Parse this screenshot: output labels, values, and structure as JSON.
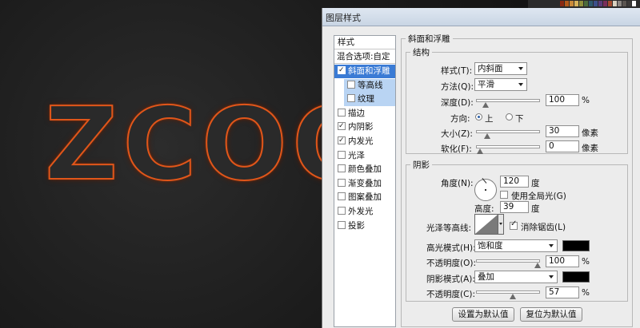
{
  "canvas": {
    "text": "ZCOO"
  },
  "topbar": {
    "swatch_colors": [
      "#8a2a12",
      "#b35a1a",
      "#c98a3a",
      "#d6b25a",
      "#8f8f3a",
      "#4c6b3a",
      "#2e5a6e",
      "#3c4f8a",
      "#5a3c7a",
      "#7a2e5a",
      "#a64a2e",
      "#d9d2c0",
      "#8a8580",
      "#5a5550",
      "#3c3a38",
      "#ffffff"
    ]
  },
  "dialog": {
    "title": "图层样式",
    "style_list": {
      "header": "样式",
      "blend": "混合选项:自定",
      "items": [
        {
          "label": "斜面和浮雕",
          "checked": true,
          "state": "selected"
        },
        {
          "label": "等高线",
          "checked": false,
          "state": "sub"
        },
        {
          "label": "纹理",
          "checked": false,
          "state": "sub"
        },
        {
          "label": "描边",
          "checked": false,
          "state": "normal"
        },
        {
          "label": "内阴影",
          "checked": true,
          "state": "normal"
        },
        {
          "label": "内发光",
          "checked": true,
          "state": "normal"
        },
        {
          "label": "光泽",
          "checked": false,
          "state": "normal"
        },
        {
          "label": "颜色叠加",
          "checked": false,
          "state": "normal"
        },
        {
          "label": "渐变叠加",
          "checked": false,
          "state": "normal"
        },
        {
          "label": "图案叠加",
          "checked": false,
          "state": "normal"
        },
        {
          "label": "外发光",
          "checked": false,
          "state": "normal"
        },
        {
          "label": "投影",
          "checked": false,
          "state": "normal"
        }
      ]
    },
    "bevel": {
      "title": "斜面和浮雕",
      "structure": {
        "title": "结构",
        "style_label": "样式(T):",
        "style_value": "内斜面",
        "technique_label": "方法(Q):",
        "technique_value": "平滑",
        "depth_label": "深度(D):",
        "depth_value": "100",
        "depth_unit": "%",
        "depth_fraction": 0.1,
        "direction_label": "方向:",
        "direction_up": "上",
        "direction_down": "下",
        "size_label": "大小(Z):",
        "size_value": "30",
        "size_unit": "像素",
        "size_fraction": 0.12,
        "soften_label": "软化(F):",
        "soften_value": "0",
        "soften_unit": "像素",
        "soften_fraction": 0.0
      },
      "shading": {
        "title": "阴影",
        "angle_label": "角度(N):",
        "angle_value": "120",
        "angle_unit": "度",
        "global_light_label": "使用全局光(G)",
        "altitude_label": "高度:",
        "altitude_value": "39",
        "altitude_unit": "度",
        "gloss_label": "光泽等高线:",
        "antialias_label": "消除锯齿(L)",
        "highlight_mode_label": "高光模式(H):",
        "highlight_mode_value": "饱和度",
        "highlight_color": "#000000",
        "highlight_opacity_label": "不透明度(O):",
        "highlight_opacity_value": "100",
        "highlight_opacity_fraction": 1.0,
        "shadow_mode_label": "阴影模式(A):",
        "shadow_mode_value": "叠加",
        "shadow_color": "#000000",
        "shadow_opacity_label": "不透明度(C):",
        "shadow_opacity_value": "57",
        "shadow_opacity_fraction": 0.57,
        "percent": "%"
      },
      "buttons": {
        "make_default": "设置为默认值",
        "reset_default": "复位为默认值"
      }
    }
  }
}
